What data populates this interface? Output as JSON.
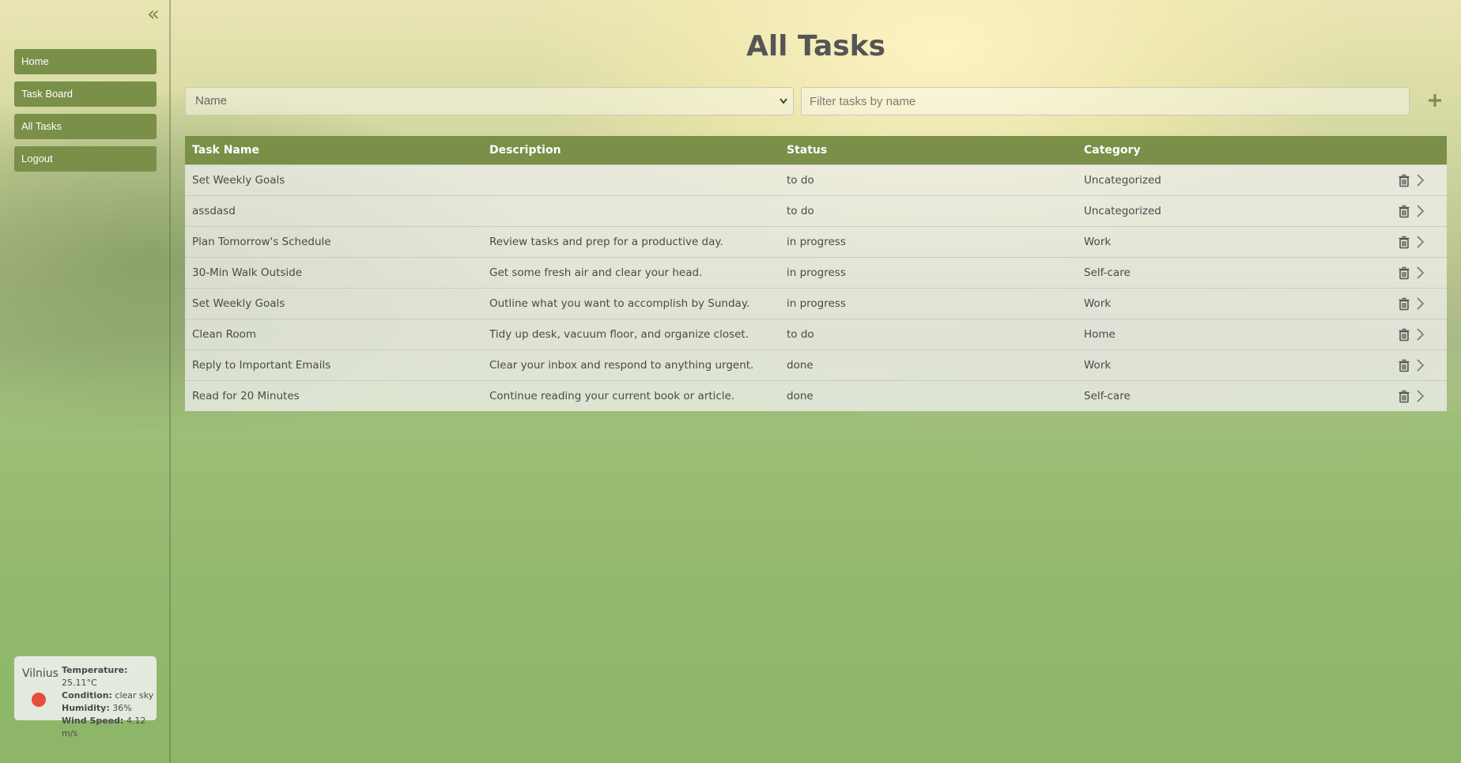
{
  "sidebar": {
    "collapse_icon": "double-chevron-left-icon",
    "items": [
      {
        "label": "Home"
      },
      {
        "label": "Task Board"
      },
      {
        "label": "All Tasks"
      },
      {
        "label": "Logout"
      }
    ]
  },
  "weather": {
    "city": "Vilnius",
    "temperature_label": "Temperature:",
    "temperature": "25.11°C",
    "condition_label": "Condition:",
    "condition": "clear sky",
    "humidity_label": "Humidity:",
    "humidity": "36%",
    "wind_label": "Wind Speed:",
    "wind": "4.12 m/s",
    "icon_color": "#e84c3d"
  },
  "page": {
    "title": "All Tasks"
  },
  "toolbar": {
    "sort_value": "Name",
    "filter_placeholder": "Filter tasks by name",
    "add_icon": "plus-icon"
  },
  "table": {
    "headers": [
      "Task Name",
      "Description",
      "Status",
      "Category"
    ],
    "rows": [
      {
        "name": "Set Weekly Goals",
        "description": "",
        "status": "to do",
        "category": "Uncategorized"
      },
      {
        "name": "assdasd",
        "description": "",
        "status": "to do",
        "category": "Uncategorized"
      },
      {
        "name": "Plan Tomorrow's Schedule",
        "description": "Review tasks and prep for a productive day.",
        "status": "in progress",
        "category": "Work"
      },
      {
        "name": "30-Min Walk Outside",
        "description": "Get some fresh air and clear your head.",
        "status": "in progress",
        "category": "Self-care"
      },
      {
        "name": "Set Weekly Goals",
        "description": "Outline what you want to accomplish by Sunday.",
        "status": "in progress",
        "category": "Work"
      },
      {
        "name": "Clean Room",
        "description": "Tidy up desk, vacuum floor, and organize closet.",
        "status": "to do",
        "category": "Home"
      },
      {
        "name": "Reply to Important Emails",
        "description": "Clear your inbox and respond to anything urgent.",
        "status": "done",
        "category": "Work"
      },
      {
        "name": "Read for 20 Minutes",
        "description": "Continue reading your current book or article.",
        "status": "done",
        "category": "Self-care"
      }
    ]
  },
  "colors": {
    "accent": "#7a8f48",
    "text": "#4a4a4a"
  }
}
